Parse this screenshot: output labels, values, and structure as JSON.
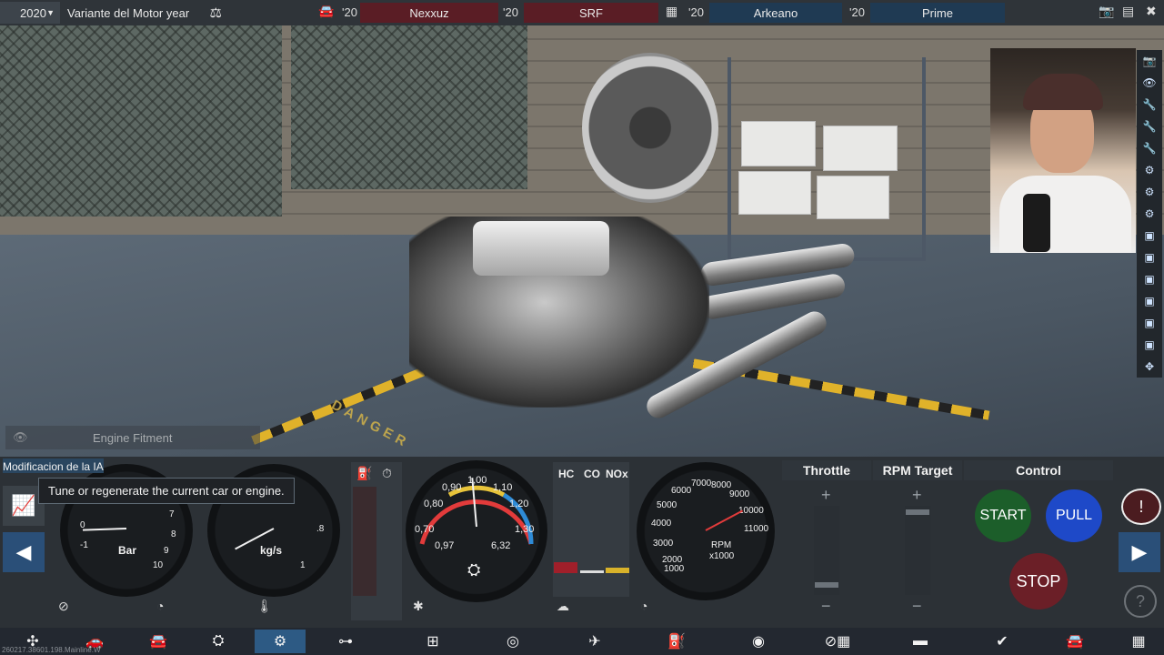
{
  "topbar": {
    "year": "2020",
    "variant": "Variante del Motor year",
    "teams": [
      {
        "year": "'20",
        "name": "Nexxuz"
      },
      {
        "year": "'20",
        "name": "SRF"
      },
      {
        "year": "'20",
        "name": "Arkeano"
      },
      {
        "year": "'20",
        "name": "Prime"
      }
    ]
  },
  "scene": {
    "engine_fitment_label": "Engine Fitment",
    "floor_text": "DANGER"
  },
  "left_panel": {
    "ai_mod_label": "Modificacion de la IA",
    "tooltip": "Tune or regenerate the current car or engine."
  },
  "gauges": {
    "boost": {
      "unit": "Bar",
      "ticks": [
        "0",
        "-1",
        "7",
        "8",
        "9",
        "10"
      ]
    },
    "flow": {
      "unit": "kg/s",
      "ticks": [
        ".8",
        "1"
      ]
    },
    "lambda": {
      "ticks": [
        "0,70",
        "0,80",
        "0,90",
        "1,00",
        "1,10",
        "1,20",
        "1,30"
      ],
      "left_value": "0,97",
      "right_value": "6,32"
    },
    "rpm": {
      "unit_line1": "RPM",
      "unit_line2": "x1000",
      "ticks": [
        "1000",
        "2000",
        "3000",
        "4000",
        "5000",
        "6000",
        "7000",
        "8000",
        "9000",
        "10000",
        "11000"
      ]
    }
  },
  "emissions": {
    "headers": [
      "HC",
      "CO",
      "NOx"
    ]
  },
  "control": {
    "throttle_label": "Throttle",
    "rpm_target_label": "RPM Target",
    "control_label": "Control",
    "start": "START",
    "pull": "PULL",
    "stop": "STOP"
  },
  "footer": {
    "version": "260217.38601.198.Mainline.W"
  },
  "colors": {
    "start": "#1c5e2a",
    "pull": "#1e49c8",
    "stop": "#6b1f27",
    "active_nav": "#2d5a84"
  }
}
